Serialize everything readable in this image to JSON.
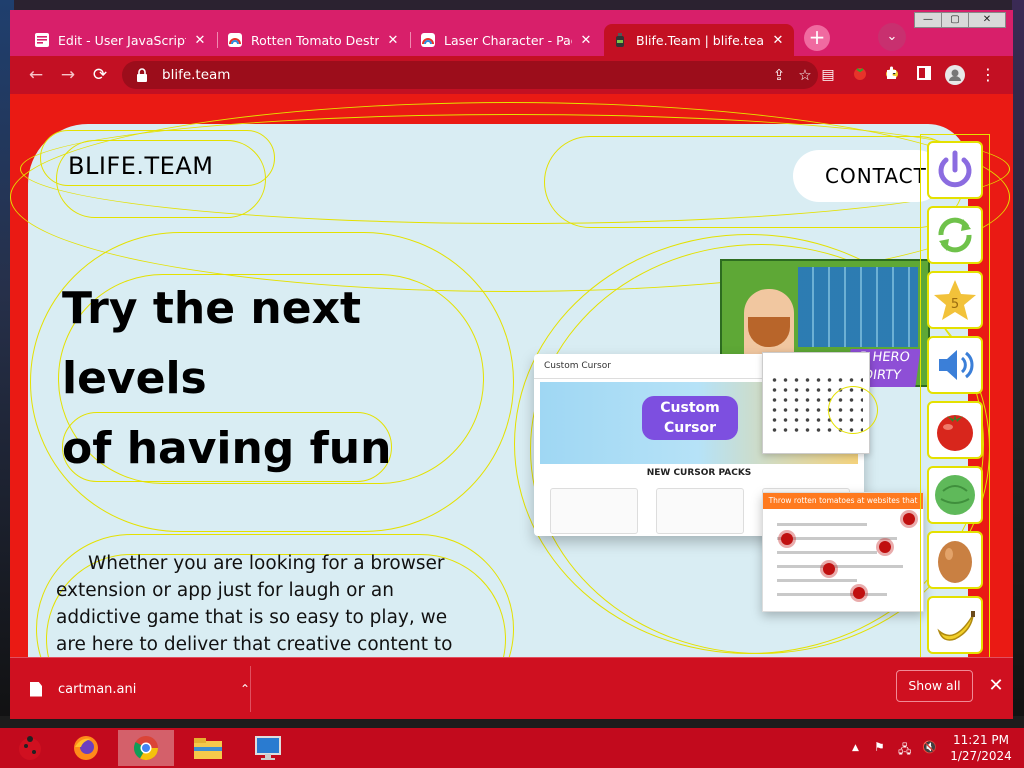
{
  "browser": {
    "tabs": [
      {
        "label": "Edit - User JavaScript and",
        "icon": "document-icon",
        "active": false
      },
      {
        "label": "Rotten Tomato Destroyer",
        "icon": "rainbow-icon",
        "active": false
      },
      {
        "label": "Laser Character - Page Ra",
        "icon": "rainbow-icon",
        "active": false
      },
      {
        "label": "Blife.Team | blife.team",
        "icon": "bottle-icon",
        "active": true
      }
    ],
    "tab_close_glyph": "✕",
    "new_tab_glyph": "+",
    "tab_search_glyph": "⌄",
    "window_controls": {
      "minimize": "—",
      "maximize": "▢",
      "close": "✕"
    },
    "nav": {
      "back": "←",
      "forward": "→",
      "reload": "⟳"
    },
    "address": {
      "url": "blife.team"
    },
    "accent_color": "#c31023"
  },
  "page": {
    "brand": "BLIFE.TEAM",
    "contact_label": "CONTACT",
    "hero_lines": [
      "Try the next",
      "levels",
      "of having fun"
    ],
    "paragraph": "Whether you are looking for a browser extension or app just for laugh or an addictive game that is so easy to play, we are here to deliver that creative content to",
    "showcase": {
      "cursor_title_top": "Custom",
      "cursor_title_bottom": "Cursor",
      "cursor_brand": "Custom Cursor",
      "new_packs": "NEW CURSOR PACKS",
      "hero_badge_top": "R HERO",
      "hero_badge_bottom": "DIRTY",
      "tomato_header": "Throw rotten tomatoes at websites that you do not like"
    },
    "tools": [
      {
        "name": "power-icon",
        "label": ""
      },
      {
        "name": "refresh-icon",
        "label": ""
      },
      {
        "name": "star-icon",
        "label": "5"
      },
      {
        "name": "speaker-icon",
        "label": ""
      },
      {
        "name": "tomato-icon",
        "label": ""
      },
      {
        "name": "cabbage-icon",
        "label": ""
      },
      {
        "name": "egg-icon",
        "label": ""
      },
      {
        "name": "banana-icon",
        "label": ""
      }
    ],
    "outline_color": "#e4e100",
    "background_color": "#ea1a14",
    "panel_color": "#d9edf3"
  },
  "downloads": {
    "file_name": "cartman.ani",
    "chevron": "⌃",
    "show_all": "Show all",
    "close_glyph": "✕"
  },
  "taskbar": {
    "apps": [
      "ladybug-icon",
      "firefox-icon",
      "chrome-icon",
      "file-explorer-icon",
      "monitor-icon"
    ],
    "tray_glyphs": {
      "up": "▲",
      "flag": "⚑",
      "network": "🖧",
      "volume": "🔇"
    },
    "time": "11:21 PM",
    "date": "1/27/2024"
  }
}
